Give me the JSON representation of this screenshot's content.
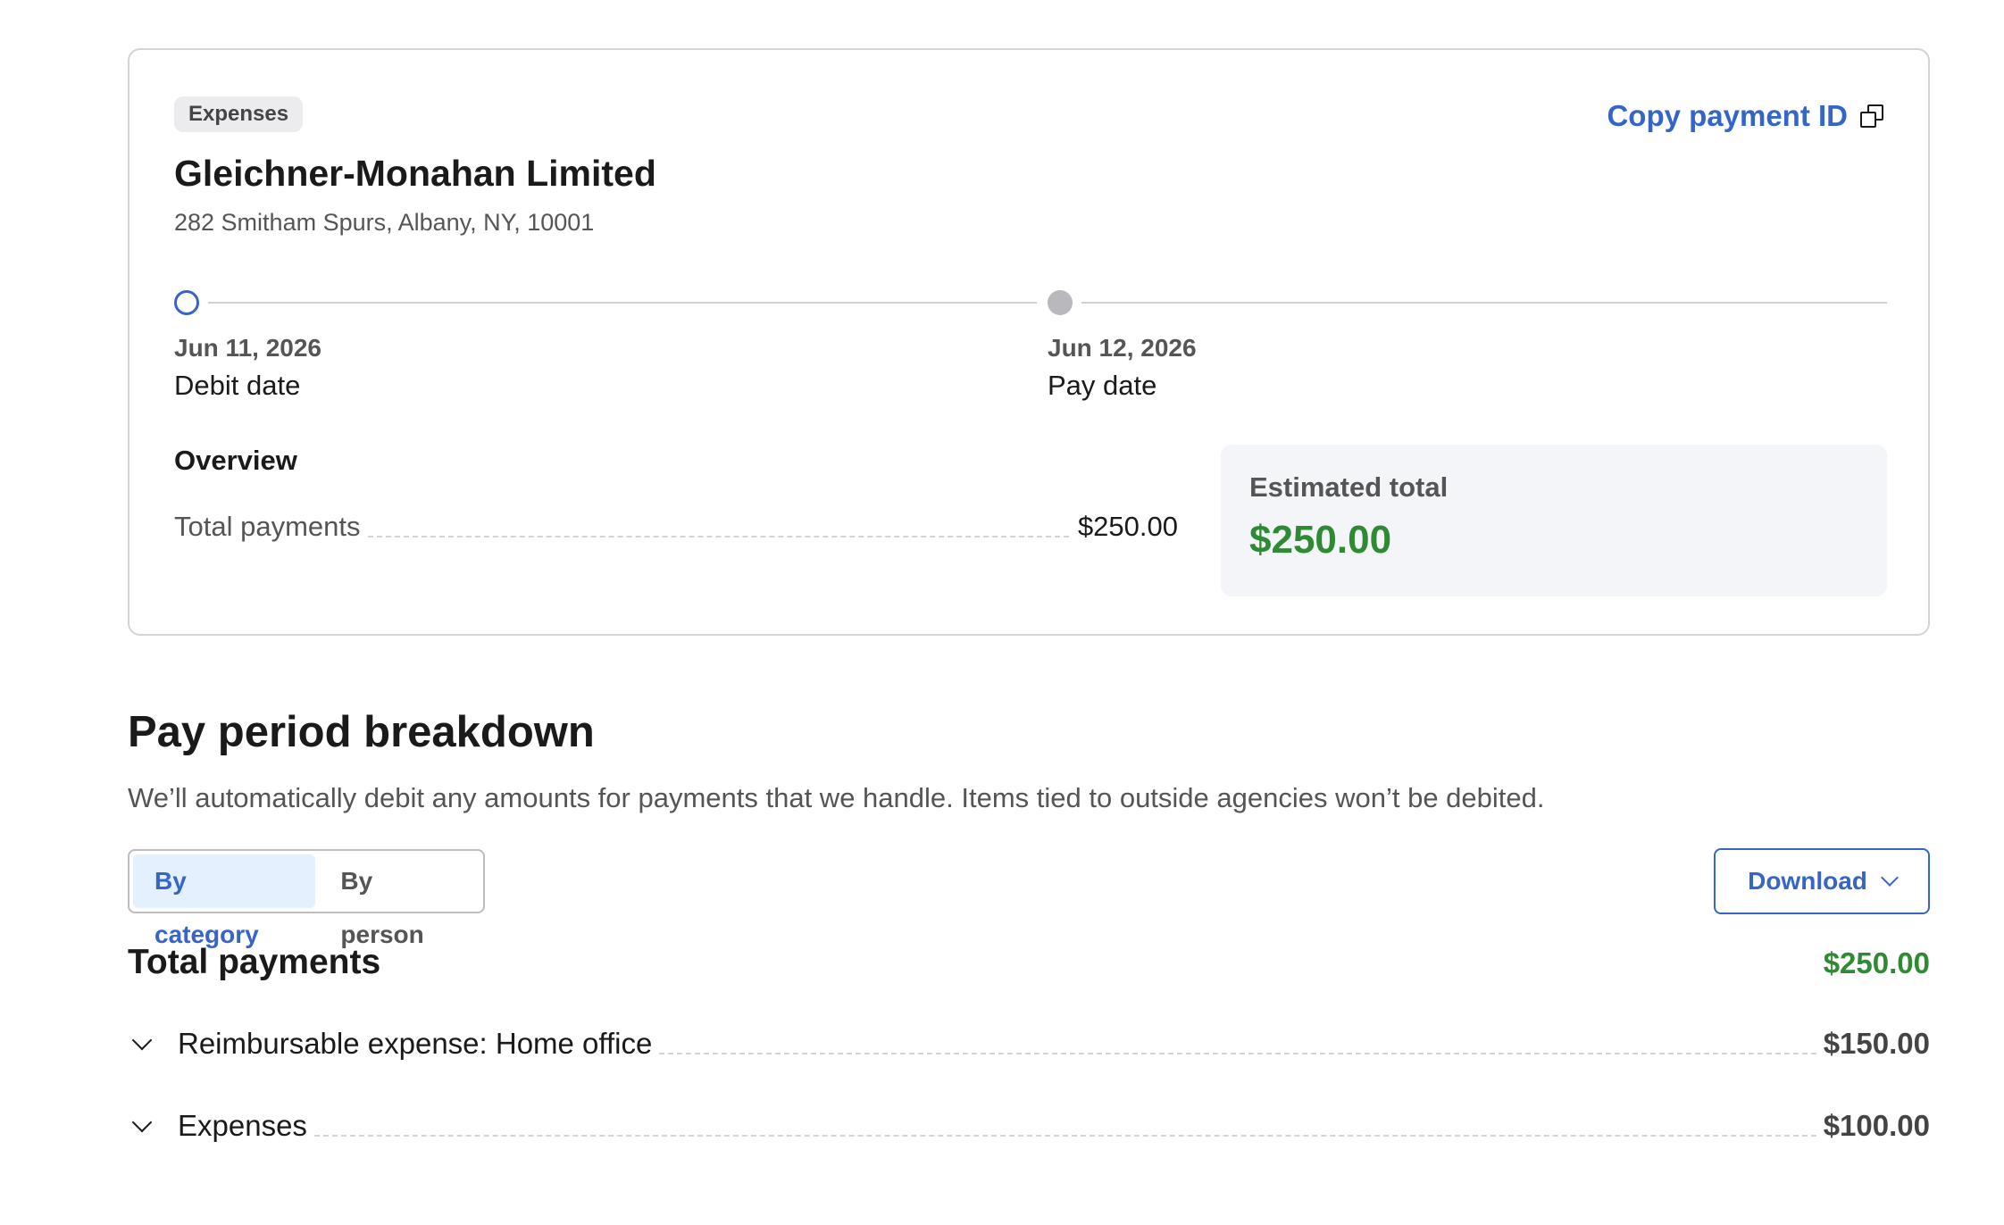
{
  "card": {
    "badge": "Expenses",
    "copy_label": "Copy payment ID",
    "copy_icon": "copy-icon",
    "company": "Gleichner-Monahan Limited",
    "address": "282 Smitham Spurs, Albany, NY, 10001",
    "timeline": [
      {
        "date": "Jun 11, 2026",
        "label": "Debit date",
        "status": "current",
        "color": "#3565c9"
      },
      {
        "date": "Jun 12, 2026",
        "label": "Pay date",
        "status": "upcoming",
        "color": "#b8b8bd"
      }
    ],
    "overview": {
      "title": "Overview",
      "rows": [
        {
          "label": "Total payments",
          "value": "$250.00"
        }
      ]
    },
    "estimated": {
      "label": "Estimated total",
      "value": "$250.00"
    }
  },
  "breakdown": {
    "title": "Pay period breakdown",
    "description": "We’ll automatically debit any amounts for payments that we handle. Items tied to outside agencies won’t be debited.",
    "tabs": [
      {
        "label": "By category",
        "active": true
      },
      {
        "label": "By person",
        "active": false
      }
    ],
    "download_label": "Download",
    "total_label": "Total payments",
    "total_value": "$250.00",
    "items": [
      {
        "label": "Reimbursable expense: Home office",
        "value": "$150.00"
      },
      {
        "label": "Expenses",
        "value": "$100.00"
      }
    ]
  },
  "colors": {
    "accent": "#3565c9",
    "positive": "#2f8a34",
    "muted": "#555555"
  }
}
